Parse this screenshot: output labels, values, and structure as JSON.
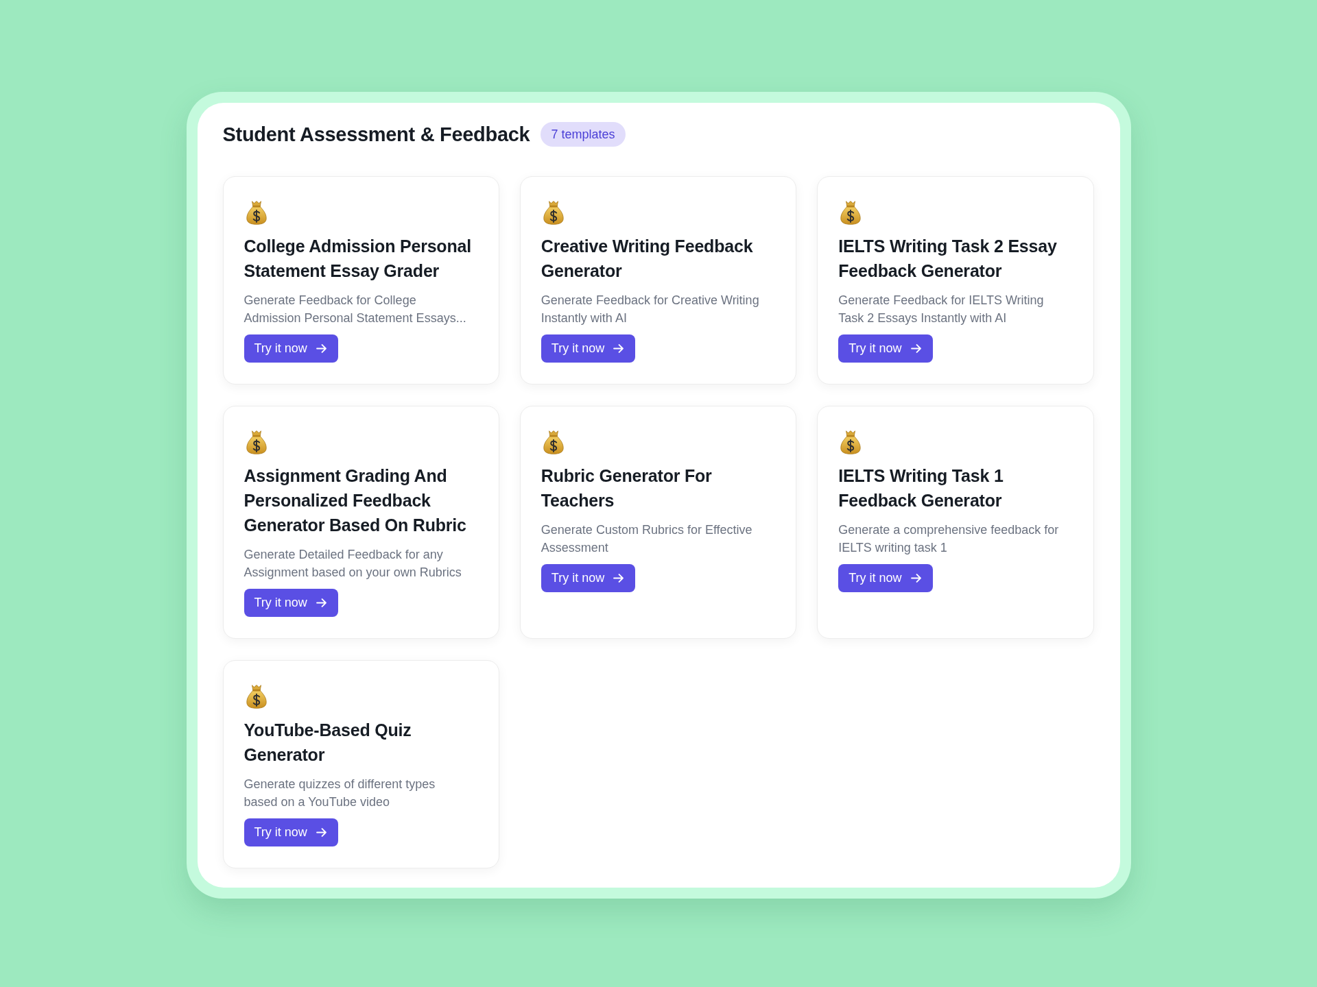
{
  "section": {
    "title": "Student Assessment & Feedback",
    "count_badge": "7 templates"
  },
  "templates": [
    {
      "title": "College Admission Personal Statement Essay Grader",
      "description": "Generate Feedback for College Admission Personal Statement Essays...",
      "button": "Try it now"
    },
    {
      "title": "Creative Writing Feedback Generator",
      "description": "Generate Feedback for Creative Writing Instantly with AI",
      "button": "Try it now"
    },
    {
      "title": "IELTS Writing Task 2 Essay Feedback Generator",
      "description": "Generate Feedback for IELTS Writing Task 2 Essays Instantly with AI",
      "button": "Try it now"
    },
    {
      "title": "Assignment Grading And Personalized Feedback Generator Based On Rubric",
      "description": "Generate Detailed Feedback for any Assignment based on your own Rubrics",
      "button": "Try it now"
    },
    {
      "title": "Rubric Generator For Teachers",
      "description": "Generate Custom Rubrics for Effective Assessment",
      "button": "Try it now"
    },
    {
      "title": "IELTS Writing Task 1 Feedback Generator",
      "description": "Generate a comprehensive feedback for IELTS writing task 1",
      "button": "Try it now"
    },
    {
      "title": "YouTube-Based Quiz Generator",
      "description": "Generate quizzes of different types based on a YouTube video",
      "button": "Try it now"
    }
  ]
}
